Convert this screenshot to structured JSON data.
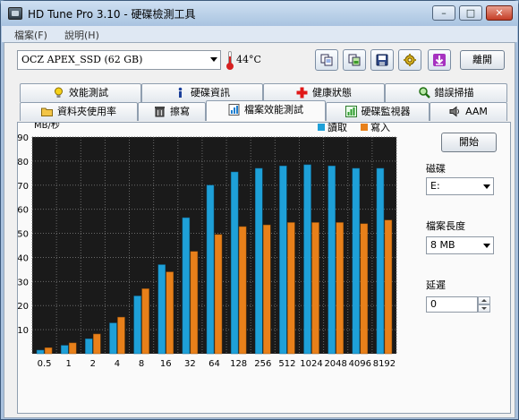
{
  "window": {
    "title": "HD Tune Pro 3.10 - 硬碟檢測工具"
  },
  "menu": {
    "items": [
      "檔案(F)",
      "說明(H)"
    ]
  },
  "toolbar": {
    "drive": "OCZ APEX_SSD (62 GB)",
    "temperature": "44°C",
    "exit_label": "離開"
  },
  "tabs": {
    "row1": [
      "效能測試",
      "硬碟資訊",
      "健康狀態",
      "錯誤掃描"
    ],
    "row2": [
      "資料夾使用率",
      "擦寫",
      "檔案效能測試",
      "硬碟監視器",
      "AAM"
    ],
    "active": "檔案效能測試"
  },
  "side": {
    "start_label": "開始",
    "drive_label": "磁碟",
    "drive_value": "E:",
    "file_length_label": "檔案長度",
    "file_length_value": "8 MB",
    "latency_label": "延遲",
    "latency_value": "0"
  },
  "colors": {
    "read": "#1ea0d8",
    "write": "#e8801a",
    "plot_bg": "#1a1a1a"
  },
  "chart_data": {
    "type": "bar",
    "ylabel": "MB/秒",
    "ylim": [
      0,
      90
    ],
    "yticks": [
      10,
      20,
      30,
      40,
      50,
      60,
      70,
      80,
      90
    ],
    "categories": [
      "0.5",
      "1",
      "2",
      "4",
      "8",
      "16",
      "32",
      "64",
      "128",
      "256",
      "512",
      "1024",
      "2048",
      "4096",
      "8192"
    ],
    "series": [
      {
        "name": "讀取",
        "values": [
          1.5,
          3.5,
          6.2,
          12.8,
          24,
          37,
          56.5,
          70,
          75.5,
          77,
          78,
          78.5,
          78,
          77,
          77
        ]
      },
      {
        "name": "寫入",
        "values": [
          2.5,
          4.5,
          8.2,
          15.2,
          27,
          34,
          42.5,
          49.5,
          52.8,
          53.5,
          54.5,
          54.5,
          54.5,
          54,
          55.5
        ]
      }
    ],
    "grid": true
  }
}
